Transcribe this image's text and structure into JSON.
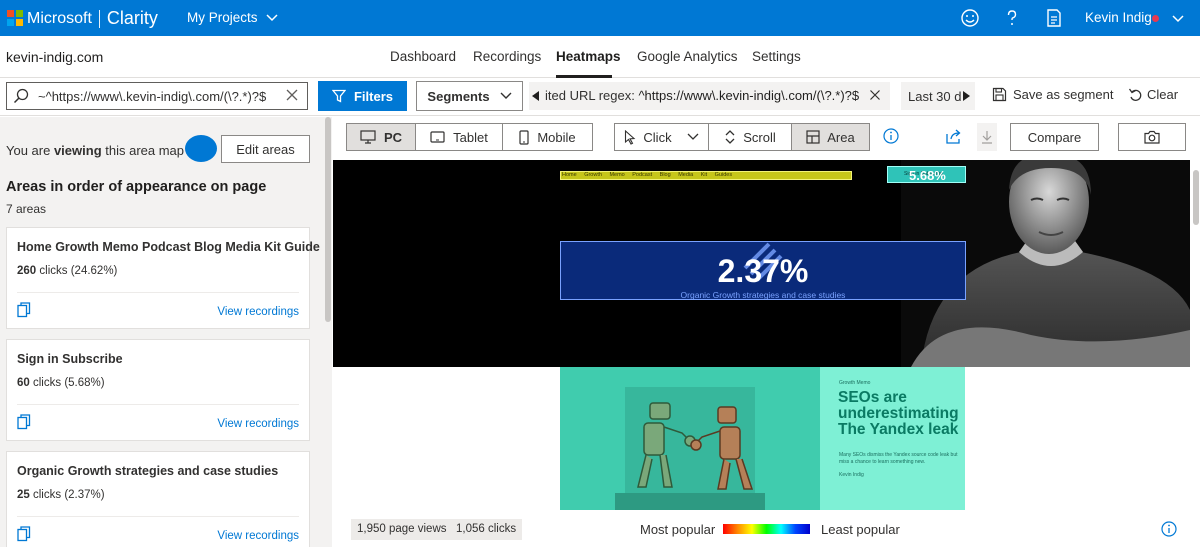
{
  "app": {
    "brand_company": "Microsoft",
    "brand_product": "Clarity",
    "projects_menu": "My Projects",
    "user_name": "Kevin Indig",
    "colors": {
      "brand": "#0078d4",
      "status_dot": "#e8384f"
    },
    "icons": [
      "smiley-icon",
      "help-icon",
      "document-icon",
      "chevron-down-icon"
    ]
  },
  "nav": {
    "site": "kevin-indig.com",
    "tabs": [
      "Dashboard",
      "Recordings",
      "Heatmaps",
      "Google Analytics",
      "Settings"
    ],
    "active_tab": "Heatmaps"
  },
  "filterbar": {
    "search_value": "~^https://www\\.kevin-indig\\.com/(\\?.*)?$",
    "filters_label": "Filters",
    "segments_label": "Segments",
    "chip_prefix": "ited URL regex: ",
    "chip_value": "^https://www\\.kevin-indig\\.com/(\\?.*)?$",
    "date_label": "Last 30 d",
    "save_segment_label": "Save as segment",
    "clear_label": "Clear"
  },
  "sidebar": {
    "viewing_pre": "You are ",
    "viewing_bold": "viewing",
    "viewing_post": " this area map",
    "edit_areas_label": "Edit areas",
    "areas_title": "Areas in order of appearance on page",
    "areas_count": "7 areas",
    "view_recordings_label": "View recordings",
    "clicks_word": "clicks",
    "areas": [
      {
        "title": "Home Growth Memo Podcast Blog Media Kit Guide",
        "clicks": "260",
        "percent": "(24.62%)"
      },
      {
        "title": "Sign in Subscribe",
        "clicks": "60",
        "percent": "(5.68%)"
      },
      {
        "title": "Organic Growth strategies and case studies",
        "clicks": "25",
        "percent": "(2.37%)"
      }
    ]
  },
  "toolbar": {
    "devices": [
      "PC",
      "Tablet",
      "Mobile"
    ],
    "selected_device": "PC",
    "modes": [
      "Click",
      "Scroll",
      "Area"
    ],
    "selected_mode": "Area",
    "compare_label": "Compare"
  },
  "preview": {
    "nav_links": "Home Growth Memo Podcast Blog Media Kit Guides",
    "sub_text": "Sign in Subscribe",
    "sub_percent": "5.68%",
    "hero_percent": "2.37%",
    "hero_subtitle": "Organic Growth strategies and case studies",
    "article_category": "Growth Memo",
    "article_title": "SEOs are underestimating The Yandex leak",
    "article_body": "Many SEOs dismiss the Yandex source code leak but miss a chance to learn something new.",
    "article_author": "Kevin Indig"
  },
  "bottombar": {
    "page_views": "1,950 page views",
    "clicks": "1,056 clicks",
    "most_popular": "Most popular",
    "least_popular": "Least popular"
  }
}
